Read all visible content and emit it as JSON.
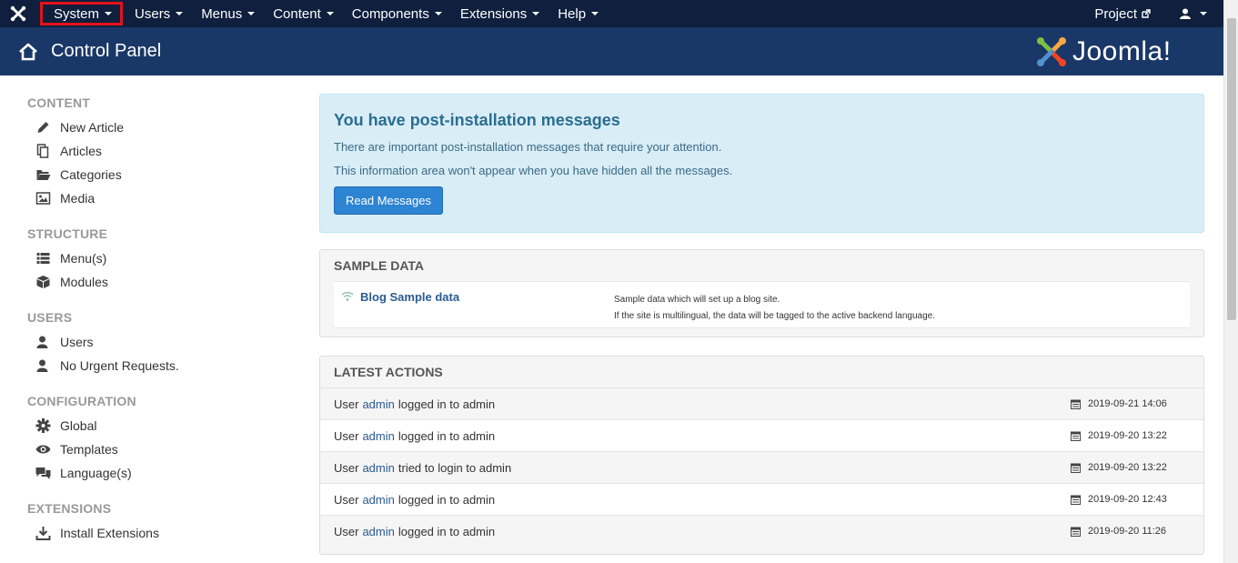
{
  "topbar": {
    "menus": [
      "System",
      "Users",
      "Menus",
      "Content",
      "Components",
      "Extensions",
      "Help"
    ],
    "project_label": "Project"
  },
  "header": {
    "title": "Control Panel",
    "brand": "Joomla!"
  },
  "sidebar": {
    "sections": [
      {
        "heading": "CONTENT",
        "items": [
          "New Article",
          "Articles",
          "Categories",
          "Media"
        ]
      },
      {
        "heading": "STRUCTURE",
        "items": [
          "Menu(s)",
          "Modules"
        ]
      },
      {
        "heading": "USERS",
        "items": [
          "Users",
          "No Urgent Requests."
        ]
      },
      {
        "heading": "CONFIGURATION",
        "items": [
          "Global",
          "Templates",
          "Language(s)"
        ]
      },
      {
        "heading": "EXTENSIONS",
        "items": [
          "Install Extensions"
        ]
      }
    ]
  },
  "alert": {
    "title": "You have post-installation messages",
    "line1": "There are important post-installation messages that require your attention.",
    "line2": "This information area won't appear when you have hidden all the messages.",
    "button": "Read Messages"
  },
  "sample_data": {
    "title": "SAMPLE DATA",
    "item_name": "Blog Sample data",
    "desc1": "Sample data which will set up a blog site.",
    "desc2": "If the site is multilingual, the data will be tagged to the active backend language."
  },
  "latest_actions": {
    "title": "LATEST ACTIONS",
    "rows": [
      {
        "prefix": "User",
        "user": "admin",
        "action": "logged in to admin",
        "date": "2019-09-21 14:06"
      },
      {
        "prefix": "User",
        "user": "admin",
        "action": "logged in to admin",
        "date": "2019-09-20 13:22"
      },
      {
        "prefix": "User",
        "user": "admin",
        "action": "tried to login to admin",
        "date": "2019-09-20 13:22"
      },
      {
        "prefix": "User",
        "user": "admin",
        "action": "logged in to admin",
        "date": "2019-09-20 12:43"
      },
      {
        "prefix": "User",
        "user": "admin",
        "action": "logged in to admin",
        "date": "2019-09-20 11:26"
      }
    ]
  },
  "colors": {
    "topbar": "#0f1f3d",
    "header": "#1a3867",
    "highlight": "#e3121b",
    "primary_button": "#2d84d3",
    "link": "#2a5b91"
  }
}
